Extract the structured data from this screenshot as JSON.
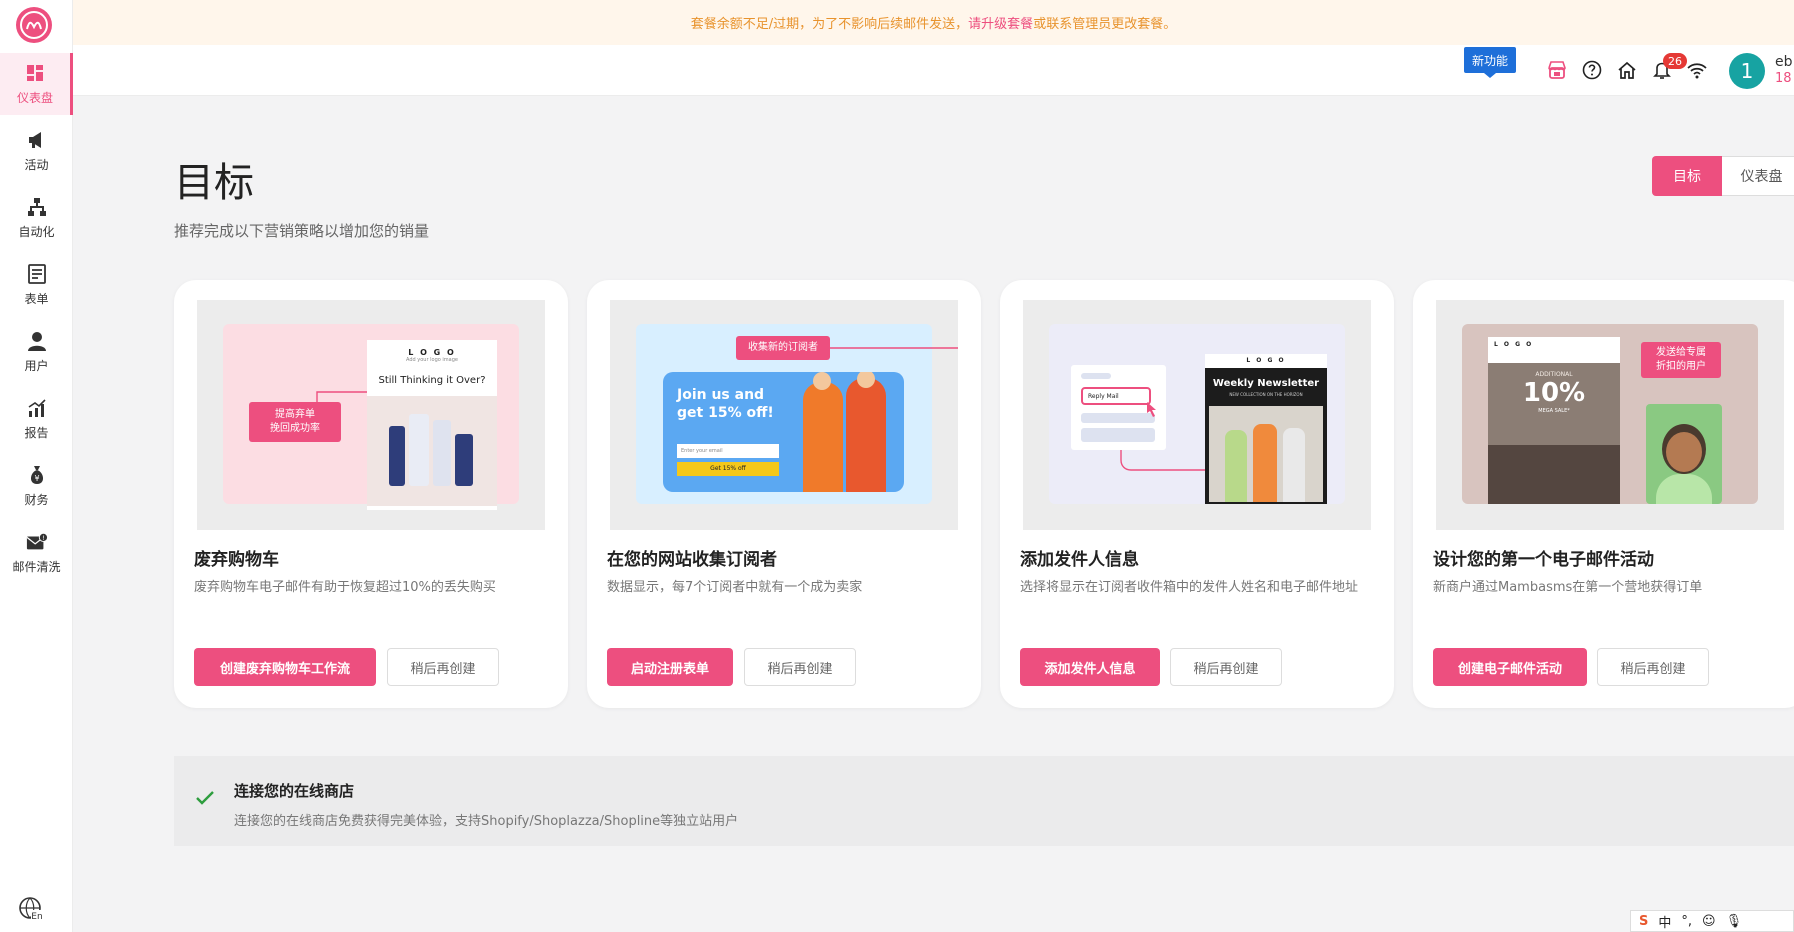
{
  "banner": {
    "text": "套餐余额不足/过期，为了不影响后续邮件发送，",
    "link": "请升级套餐",
    "tail": " 或联系管理员更改套餐。"
  },
  "sidebar": {
    "items": [
      {
        "label": "仪表盘",
        "icon": "dashboard-icon",
        "active": true
      },
      {
        "label": "活动",
        "icon": "megaphone-icon"
      },
      {
        "label": "自动化",
        "icon": "hierarchy-icon"
      },
      {
        "label": "表单",
        "icon": "form-icon"
      },
      {
        "label": "用户",
        "icon": "user-icon"
      },
      {
        "label": "报告",
        "icon": "report-chart-icon"
      },
      {
        "label": "财务",
        "icon": "money-bag-icon"
      },
      {
        "label": "邮件清洗",
        "icon": "mail-clean-icon"
      }
    ]
  },
  "header": {
    "new_feature": "新功能",
    "notification_count": "26",
    "avatar_letter": "1",
    "user_name": "eb",
    "user_sub": "18"
  },
  "main": {
    "title": "目标",
    "subtitle": "推荐完成以下营销策略以增加您的销量",
    "toggle": {
      "active": "目标",
      "inactive": "仪表盘"
    }
  },
  "cards": [
    {
      "title": "废弃购物车",
      "desc": "废弃购物车电子邮件有助于恢复超过10%的丢失购买",
      "primary": "创建废弃购物车工作流",
      "secondary": "稍后再创建",
      "illus": {
        "tag_line1": "提高弃单",
        "tag_line2": "挽回成功率",
        "logo": "L O G O",
        "logo_sub": "Add your logo image",
        "headline": "Still Thinking it Over?"
      }
    },
    {
      "title": "在您的网站收集订阅者",
      "desc": "数据显示，每7个订阅者中就有一个成为卖家",
      "primary": "启动注册表单",
      "secondary": "稍后再创建",
      "illus": {
        "tag": "收集新的订阅者",
        "headline_1": "Join us and",
        "headline_2": "get 15% off!",
        "input": "Enter your email",
        "cta": "Get 15% off"
      }
    },
    {
      "title": "添加发件人信息",
      "desc": "选择将显示在订阅者收件箱中的发件人姓名和电子邮件地址",
      "primary": "添加发件人信息",
      "secondary": "稍后再创建",
      "illus": {
        "reply": "Reply Mail",
        "logo": "L O G O",
        "headline": "Weekly Newsletter",
        "sub": "NEW COLLECTION ON THE HORIZON"
      }
    },
    {
      "title": "设计您的第一个电子邮件活动",
      "desc": "新商户通过Mambasms在第一个营地获得订单",
      "primary": "创建电子邮件活动",
      "secondary": "稍后再创建",
      "illus": {
        "logo": "L O G O",
        "tag_line1": "发送给专属",
        "tag_line2": "折扣的用户",
        "additional": "ADDITIONAL",
        "percent": "10%",
        "mega": "MEGA SALE*"
      }
    }
  ],
  "connect": {
    "title": "连接您的在线商店",
    "desc": "连接您的在线商店免费获得完美体验，支持Shopify/Shoplazza/Shopline等独立站用户"
  },
  "ime": {
    "lang": "中"
  },
  "colors": {
    "accent": "#ed4f7f",
    "banner_text": "#e8932d",
    "avatar": "#17a3a2",
    "badge": "#1e6fd9"
  }
}
